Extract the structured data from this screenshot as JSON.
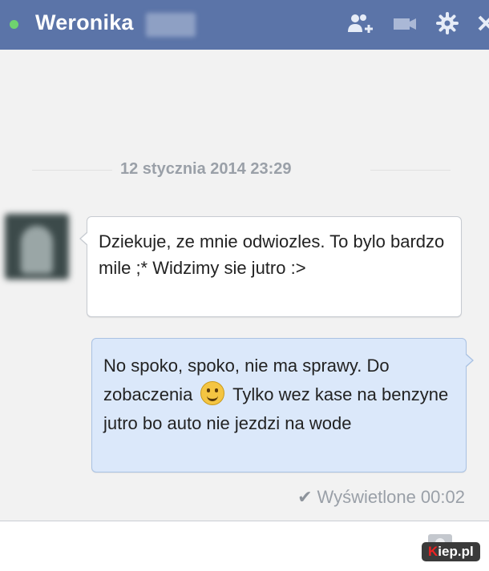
{
  "header": {
    "contact_name": "Weronika",
    "icons": [
      "add-friend-icon",
      "video-call-icon",
      "gear-icon",
      "close-icon"
    ],
    "status_color": "#6fd36f",
    "bar_color": "#5b74a8"
  },
  "conversation": {
    "date_separator": "12 stycznia 2014 23:29",
    "messages": [
      {
        "direction": "incoming",
        "text": "Dziekuje, ze mnie odwiozles. To bylo bardzo mile ;* Widzimy sie jutro :>"
      },
      {
        "direction": "outgoing",
        "text_before_emoji": "No spoko, spoko, nie ma sprawy. Do zobaczenia",
        "emoji": "smiley-emoji",
        "text_after_emoji": "Tylko wez kase na benzyne jutro bo auto nie jezdzi na wode"
      }
    ],
    "seen_status": "Wyświetlone 00:02"
  },
  "watermark": {
    "first_letter": "K",
    "rest": "iep.pl"
  }
}
